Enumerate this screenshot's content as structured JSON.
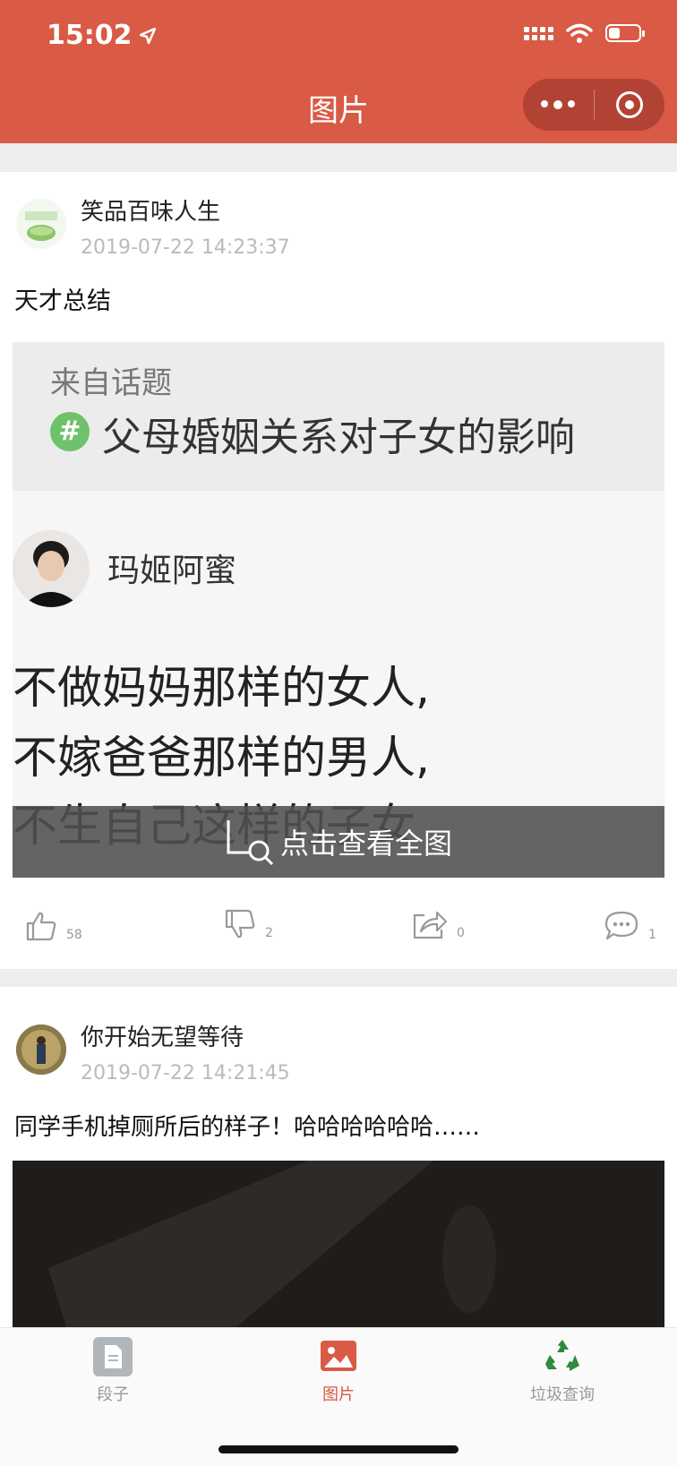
{
  "status_bar": {
    "time": "15:02"
  },
  "nav": {
    "title": "图片"
  },
  "posts": [
    {
      "author": "笑品百味人生",
      "time": "2019-07-22 14:23:37",
      "text": "天才总结",
      "image": {
        "topic_label": "来自话题",
        "topic_title": "父母婚姻关系对子女的影响",
        "user": "玛姬阿蜜",
        "lines": [
          "不做妈妈那样的女人,",
          "不嫁爸爸那样的男人,",
          "不生自己这样的子女"
        ]
      },
      "view_full": "点击查看全图",
      "likes": "58",
      "dislikes": "2",
      "shares": "0",
      "comments": "1"
    },
    {
      "author": "你开始无望等待",
      "time": "2019-07-22 14:21:45",
      "text": "同学手机掉厕所后的样子！哈哈哈哈哈哈……"
    }
  ],
  "tabbar": {
    "tabs": [
      {
        "label": "段子",
        "icon": "document-icon"
      },
      {
        "label": "图片",
        "icon": "image-icon",
        "active": true
      },
      {
        "label": "垃圾查询",
        "icon": "recycle-icon"
      }
    ]
  },
  "colors": {
    "accent": "#d95a45",
    "muted": "#bbbbbb"
  }
}
